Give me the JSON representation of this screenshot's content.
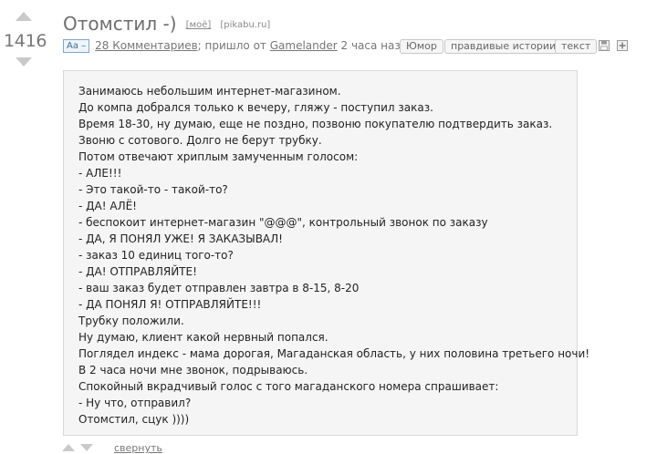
{
  "post": {
    "rating": "1416",
    "title": "Отомстил -)",
    "my_link": "[моё]",
    "source_link": "[pikabu.ru]",
    "font_toggle": "Aa –",
    "comments_link": "28 Комментариев",
    "from_text": "; пришло от ",
    "author": "Gamelander",
    "time_ago": " 2 часа назад",
    "tags": [
      "Юмор",
      "правдивые истории",
      "текст"
    ],
    "lines": [
      "Занимаюсь небольшим интернет-магазином.",
      "До компа добрался только к вечеру, гляжу - поступил заказ.",
      "Время 18-30, ну думаю, еще не поздно, позвоню покупателю подтвердить заказ.",
      "Звоню с сотового. Долго не берут трубку.",
      "Потом отвечают хриплым замученным голосом:",
      "- АЛЕ!!!",
      "- Это такой-то - такой-то?",
      "- ДА! АЛЁ!",
      "- беспокоит интернет-магазин \"@@@\", контрольный звонок по заказу",
      "- ДА, Я ПОНЯЛ УЖЕ! Я ЗАКАЗЫВАЛ!",
      "- заказ 10 единиц того-то?",
      "- ДА! ОТПРАВЛЯЙТЕ!",
      "- ваш заказ будет отправлен завтра в 8-15, 8-20",
      "- ДА ПОНЯЛ Я! ОТПРАВЛЯЙТЕ!!!",
      "Трубку положили.",
      "Ну думаю, клиент какой нервный попался.",
      "Поглядел индекс - мама дорогая, Магаданская область, у них половина третьего ночи!",
      "В 2 часа ночи мне звонок, подрываюсь.",
      "Спокойный вкрадчивый голос с того магаданского номера спрашивает:",
      "- Ну что, отправил?",
      "Отомстил, сцук ))))"
    ],
    "collapse_label": "свернуть"
  },
  "icons": {
    "vote_up": "arrow-up-icon",
    "vote_down": "arrow-down-icon",
    "save": "floppy-disk-icon",
    "expand": "plus-box-icon"
  },
  "colors": {
    "accent_blue": "#3a6f9c",
    "story_bg": "#f5f5f5",
    "story_border": "#d8d8d8"
  }
}
